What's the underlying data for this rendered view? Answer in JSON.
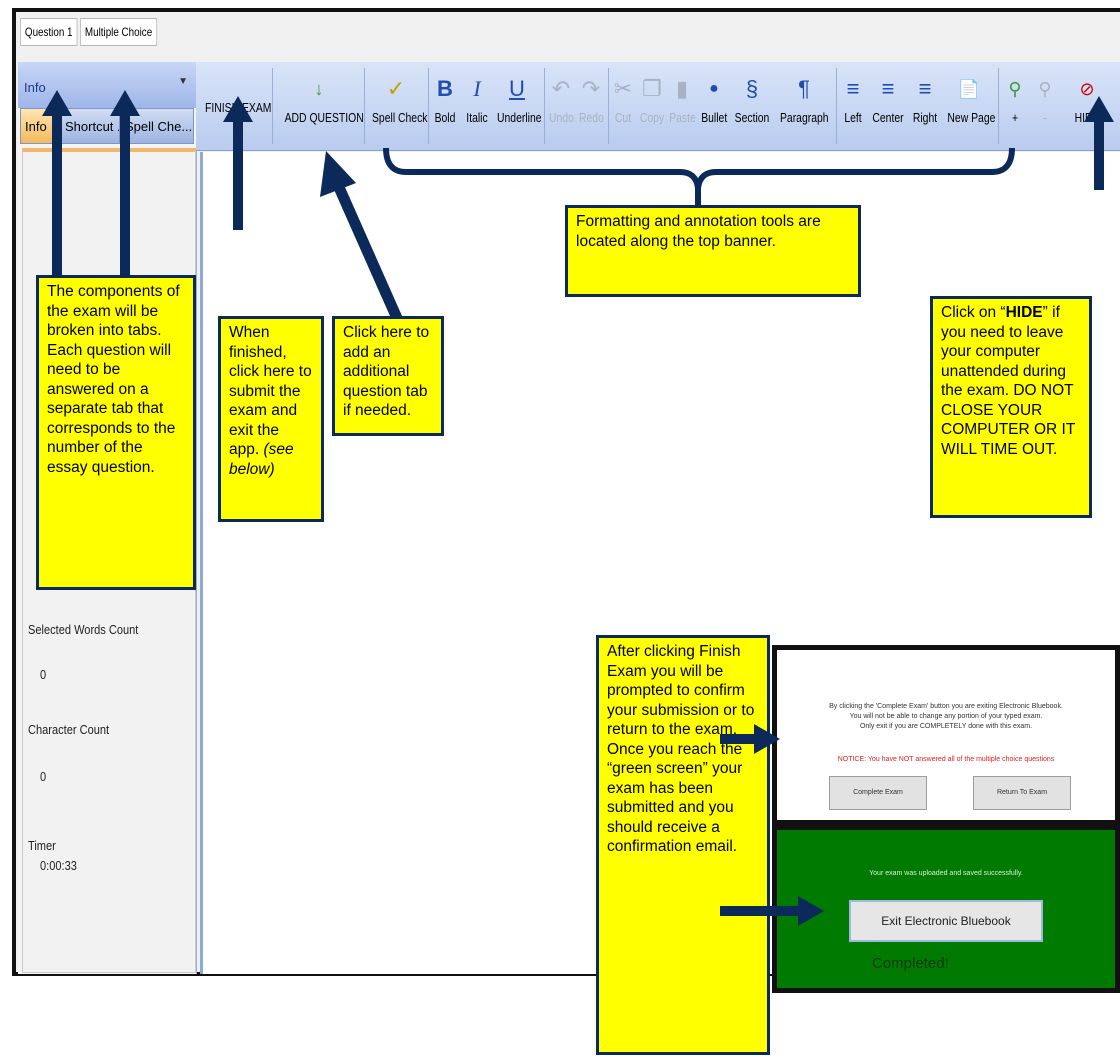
{
  "question_tabs": [
    "Question 1",
    "Multiple Choice"
  ],
  "side_panel": {
    "title": "Info",
    "pin_icon": "pin-icon",
    "tabs": [
      "Info",
      "Shortcut ...",
      "Spell Che..."
    ],
    "selected_words_label": "Selected Words Count",
    "selected_words_value": "0",
    "character_count_label": "Character Count",
    "character_count_value": "0",
    "timer_label": "Timer",
    "timer_value": "0:00:33"
  },
  "toolbar": {
    "finish_exam": "FINISH EXAM",
    "add_question": "ADD QUESTION",
    "spell_check": "Spell Check",
    "bold": "Bold",
    "italic": "Italic",
    "underline": "Underline",
    "undo": "Undo",
    "redo": "Redo",
    "cut": "Cut",
    "copy": "Copy",
    "paste": "Paste",
    "bullet": "Bullet",
    "section": "Section",
    "paragraph": "Paragraph",
    "left": "Left",
    "center": "Center",
    "right": "Right",
    "new_page": "New Page",
    "zoom_in": "+",
    "zoom_out": "-",
    "hide": "HIDE"
  },
  "callouts": {
    "tabs_note": "The components of the exam will be broken into tabs. Each question will need to be answered on a separate tab that corresponds to the number of the essay question.",
    "finish_note": "When finished, click here to submit the exam and exit the app.",
    "finish_note_italic": "(see below)",
    "add_note": "Click here to add an additional question tab if needed.",
    "format_note": "Formatting and annotation tools are located along the top banner.",
    "hide_note_pre": "Click on “",
    "hide_note_bold": "HIDE",
    "hide_note_post": "” if you need to leave your computer unattended during the exam. DO NOT CLOSE YOUR COMPUTER OR IT WILL TIME OUT.",
    "after_note": "After clicking Finish Exam you will be prompted to confirm your submission or to return to the exam. Once you reach the “green screen” your exam has been submitted and you should receive a confirmation email."
  },
  "confirm_dialog": {
    "line1": "By clicking the 'Complete Exam' button you are exiting Electronic Bluebook.",
    "line2": "You will not be able to change any portion of your typed exam.",
    "line3": "Only exit if you are COMPLETELY done with this exam.",
    "notice": "NOTICE: You have NOT answered all of the multiple choice questions",
    "complete_btn": "Complete Exam",
    "return_btn": "Return To Exam"
  },
  "success_dialog": {
    "message": "Your exam was uploaded and saved successfully.",
    "exit_btn": "Exit Electronic Bluebook",
    "completed": "Completed!"
  },
  "colors": {
    "note_yellow": "#ffff00",
    "arrow_navy": "#0b2a5a",
    "success_green": "#007a00",
    "notice_red": "#e02020"
  }
}
